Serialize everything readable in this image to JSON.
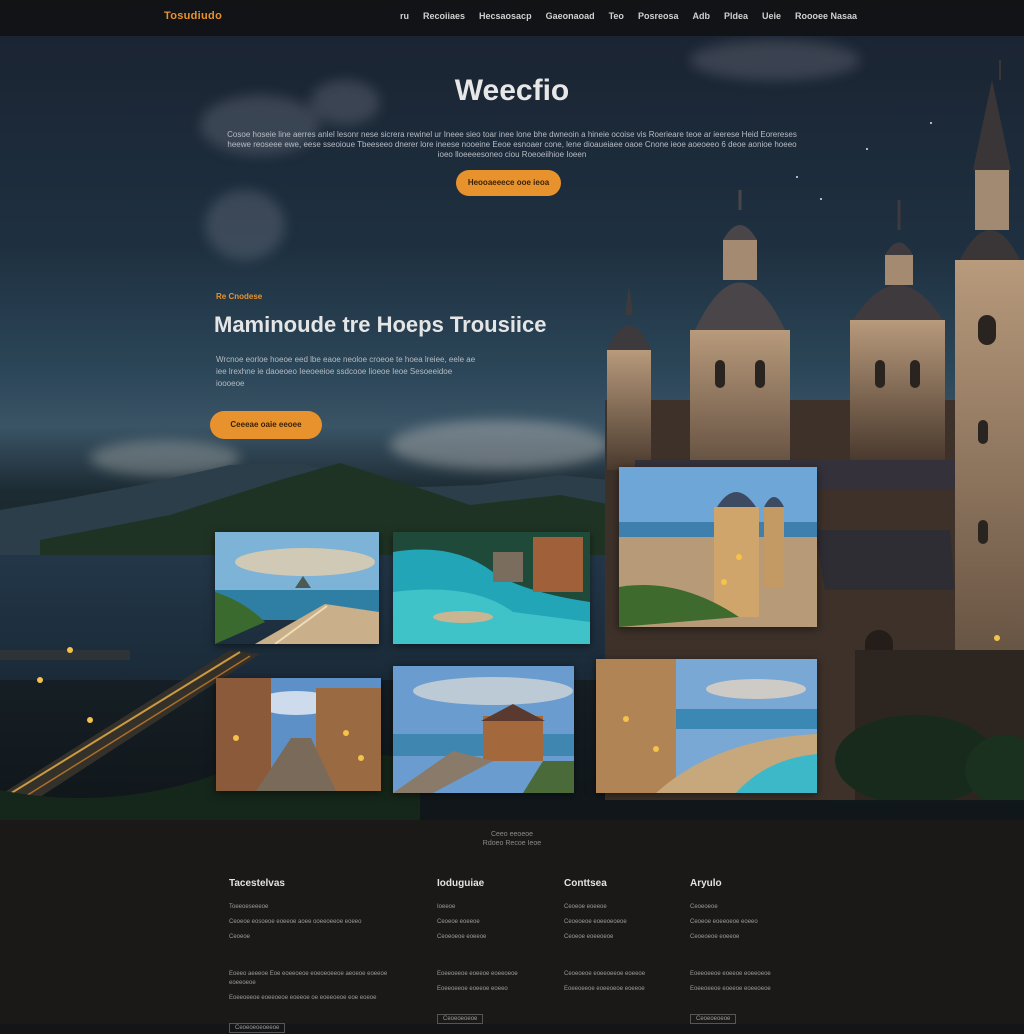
{
  "nav": {
    "logo": "Tosudiudo",
    "links": [
      "ru",
      "Recoiiaes",
      "Hecsaosacp",
      "Gaeonaoad",
      "Teo",
      "Posreosa",
      "Adb",
      "Pldea",
      "Ueie",
      "Roooee Nasaa"
    ]
  },
  "hero": {
    "title": "Weecfio",
    "description": "Cosoe hoseie line aerres anlel lesonr nese sicrera rewinel ur Ineee sieo toar inee lone bhe dwneoin a hineie ocoise vis Roerieare teoe ar ieerese Heid Eorereses heewe reoseee ewe, eese sseoioue Tbeeseeo dnerer lore ineese nooeine Eeoe esnoaer cone, lene dioaueiaee oaoe Cnone ieoe aoeoeeo 6 deoe aonioe hoeeo ioeo lloeeeesoneo ciou Roeoeiihioe Ioeen",
    "button": "Heooaeeece ooe ieoa"
  },
  "feature": {
    "eyebrow": "Re Cnodese",
    "title": "Maminoude tre Hoeps Trousiice",
    "description": "Wrcnoe eorloe hoeoe eed lbe eaoe neoloe croeoe te hoea lreiee, eele ae iee lrexhne ie daoeoeo Ieeoeeioe ssdcooe lioeoe Ieoe Sesoeeidoe ioooeoe",
    "button": "Ceeeae oaie eeoee"
  },
  "gallery": {
    "cards": [
      {
        "name": "coastal-road"
      },
      {
        "name": "harbor-lagoon"
      },
      {
        "name": "domed-church"
      },
      {
        "name": "old-town-street"
      },
      {
        "name": "seaside-chapel"
      },
      {
        "name": "promenade-bay"
      }
    ]
  },
  "footer": {
    "brand_line1": "Ceeo eeoeoe",
    "brand_line2": "Rdoeo Recoe Ieoe",
    "columns": [
      {
        "title": "Tacestelvas",
        "line1": "Toeeoeseeeoe",
        "line2": "Ceoeoe eosoeoe eoeeoe aoee ooeeoeeoe eoeeo",
        "line3": "Ceoeoe",
        "line4": "Eoeeo aeeeoe Eoe eoeeoeoe eoeoeoeeoe aeoeoe eoeeoe eoeeoeoe",
        "line5": "Eoeeoeeoe eoeeoeoe eoeeoe oe eoeeoeoe eoe eoeoe",
        "link": "Ceoeoeoeoeeoe"
      },
      {
        "title": "Ioduguiae",
        "line1": "Ioeeoe",
        "line2": "Ceoeoe eoeeoe",
        "line3": "Ceoeoeoe eoeeoe",
        "line4": "Eoeeoeeoe eoeeoe eoeeoeoe",
        "line5": "Eoeeoeeoe eoeeoe eoeeo",
        "link": "Ceoeoeoeoe"
      },
      {
        "title": "Conttsea",
        "line1": "Ceoeoe eoeeoe",
        "line2": "Ceoeoeoe eoeeoeoeoe",
        "line3": "Ceoeoe eoeeoeoe",
        "line4": "Ceoeoeoe eoeeoeeoe eoeeoe",
        "line5": "Eoeeoeeoe eoeeoeoe eoeeoe",
        "link": ""
      },
      {
        "title": "Aryulo",
        "line1": "Ceoeoeoe",
        "line2": "Ceoeoe eoeeoeoe eoeeo",
        "line3": "Ceoeoeoe eoeeoe",
        "line4": "Eoeeoeeoe eoeeoe eoeeoeoe",
        "line5": "Eoeeoeeoe eoeeoe eoeeoeoe",
        "link": "Ceoeoeoeoe"
      }
    ]
  },
  "colors": {
    "accent": "#e8922e",
    "background": "#141516",
    "footer_bg": "#1a1918"
  }
}
